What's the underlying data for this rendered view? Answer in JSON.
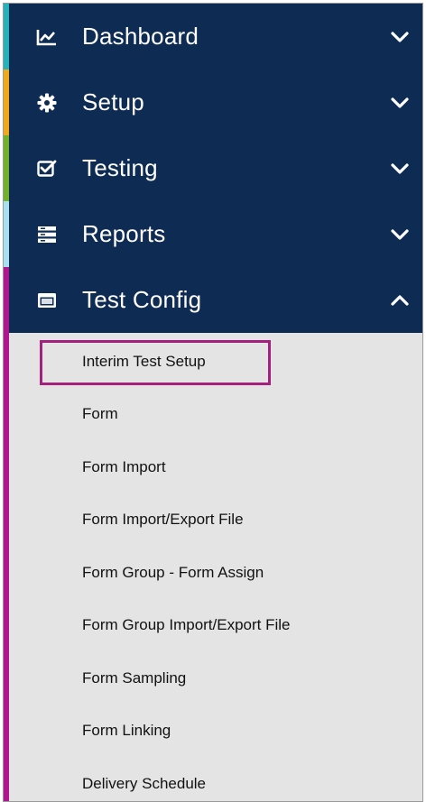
{
  "colors": {
    "nav_background": "#0e2c53",
    "submenu_background": "#e4e4e4",
    "highlight_border": "#a3207f",
    "accent_dashboard": "#26b2b8",
    "accent_setup": "#f2a81d",
    "accent_testing": "#73b12a",
    "accent_reports": "#a9e0f0",
    "accent_test_config": "#b0168e"
  },
  "nav": {
    "items": [
      {
        "label": "Dashboard",
        "icon": "line-chart-icon",
        "state": "collapsed"
      },
      {
        "label": "Setup",
        "icon": "gear-icon",
        "state": "collapsed"
      },
      {
        "label": "Testing",
        "icon": "checkbox-icon",
        "state": "collapsed"
      },
      {
        "label": "Reports",
        "icon": "list-icon",
        "state": "collapsed"
      },
      {
        "label": "Test Config",
        "icon": "window-icon",
        "state": "expanded"
      }
    ]
  },
  "submenu": {
    "highlighted_item": "Interim Test Setup",
    "items": [
      "Interim Test Setup",
      "Form",
      "Form Import",
      "Form Import/Export File",
      "Form Group - Form Assign",
      "Form Group Import/Export File",
      "Form Sampling",
      "Form Linking",
      "Delivery Schedule"
    ]
  }
}
